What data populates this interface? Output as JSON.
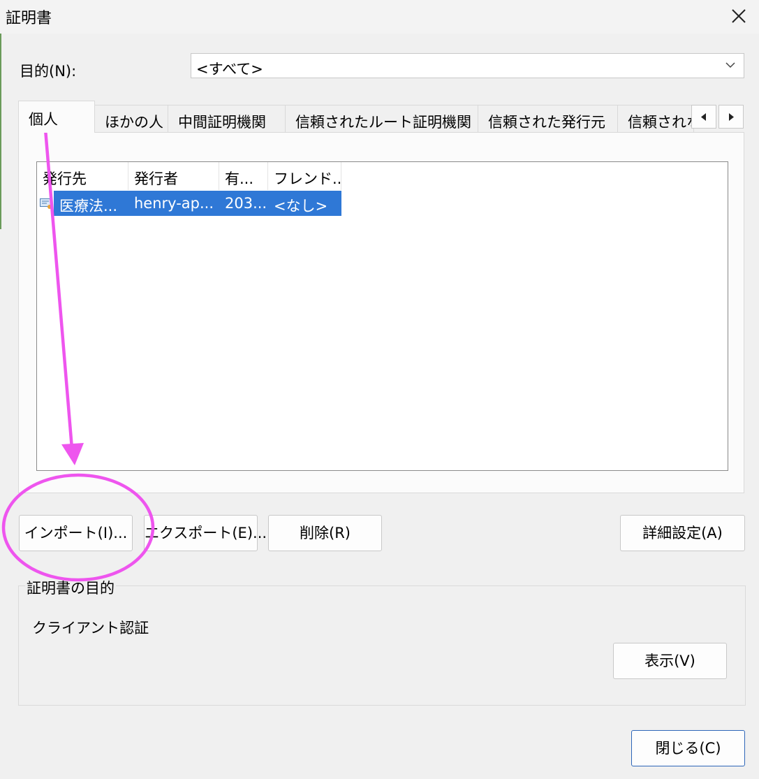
{
  "window": {
    "title": "証明書"
  },
  "purpose": {
    "label": "目的(N):",
    "value": "<すべて>"
  },
  "tabs": [
    {
      "label": "個人"
    },
    {
      "label": "ほかの人"
    },
    {
      "label": "中間証明機関"
    },
    {
      "label": "信頼されたルート証明機関"
    },
    {
      "label": "信頼された発行元"
    },
    {
      "label": "信頼されな"
    }
  ],
  "table": {
    "columns": [
      "発行先",
      "発行者",
      "有...",
      "フレンド..."
    ],
    "rows": [
      {
        "issued_to": "医療法...",
        "issued_by": "henry-ap...",
        "expiry": "203...",
        "friendly_name": "<なし>"
      }
    ]
  },
  "buttons": {
    "import": "インポート(I)...",
    "export": "エクスポート(E)...",
    "remove": "削除(R)",
    "advanced": "詳細設定(A)",
    "view": "表示(V)",
    "close": "閉じる(C)"
  },
  "purpose_group": {
    "title": "証明書の目的",
    "value": "クライアント認証"
  },
  "annotation": {
    "color": "#ee55ee"
  },
  "icons": [
    "close-icon",
    "chevron-down-icon",
    "scroll-left-icon",
    "scroll-right-icon",
    "certificate-icon"
  ]
}
